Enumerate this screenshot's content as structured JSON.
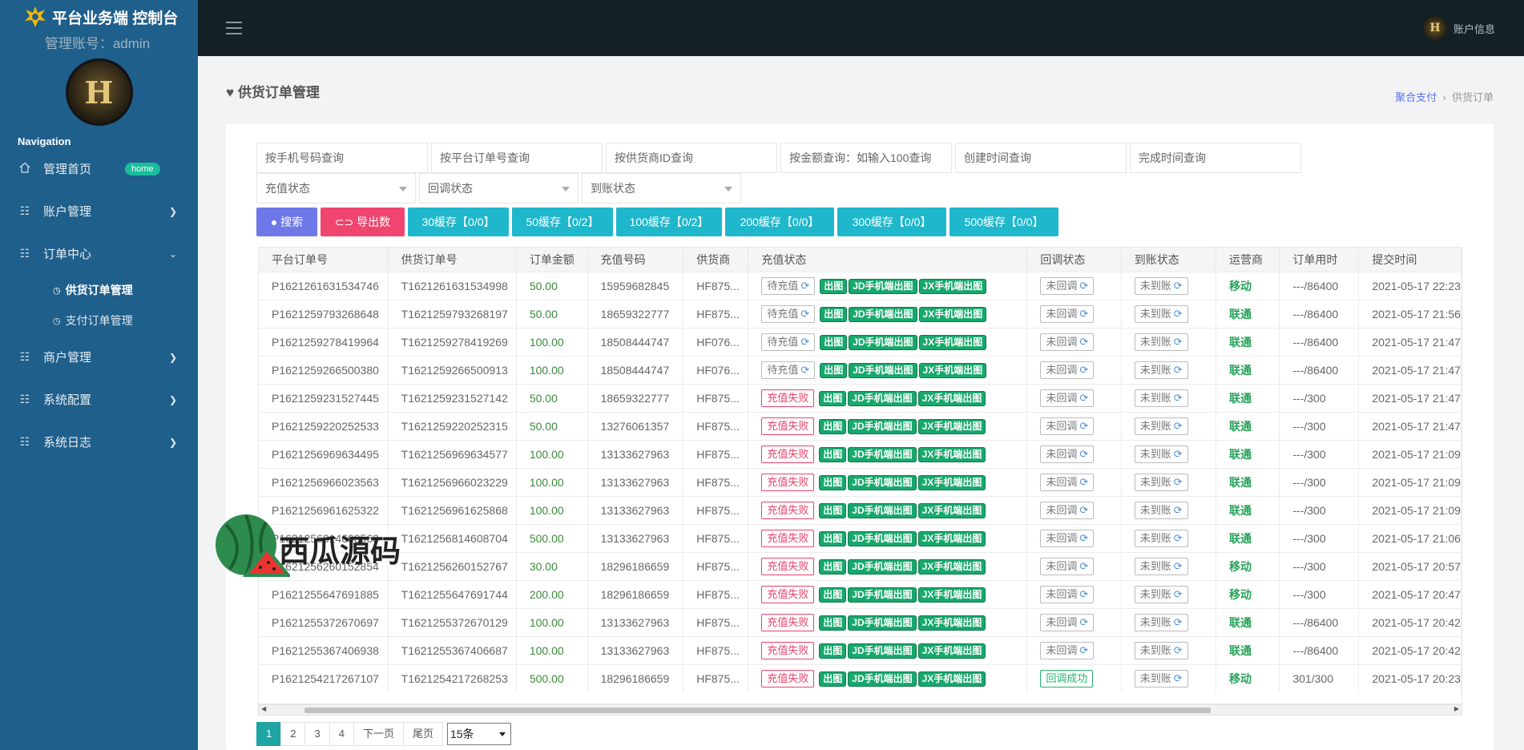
{
  "sidebar": {
    "brand": "平台业务端 控制台",
    "admin_line": "管理账号：admin",
    "avatar_letter": "H",
    "nav_caption": "Navigation",
    "items": [
      {
        "label": "管理首页",
        "badge": "home",
        "icon": "home-icon"
      },
      {
        "label": "账户管理",
        "icon": "list-icon"
      },
      {
        "label": "订单中心",
        "icon": "list-icon",
        "expanded": true,
        "children": [
          {
            "label": "供货订单管理",
            "active": true
          },
          {
            "label": "支付订单管理"
          }
        ]
      },
      {
        "label": "商户管理",
        "icon": "list-icon"
      },
      {
        "label": "系统配置",
        "icon": "list-icon"
      },
      {
        "label": "系统日志",
        "icon": "list-icon"
      }
    ]
  },
  "topbar": {
    "account_label": "账户信息"
  },
  "page": {
    "title": "供货订单管理",
    "breadcrumb": [
      "聚合支付",
      "供货订单"
    ]
  },
  "filters": {
    "phone": "按手机号码查询",
    "platform_order": "按平台订单号查询",
    "supplier_id": "按供货商ID查询",
    "amount": "按金额查询：如输入100查询",
    "created_time": "创建时间查询",
    "finished_time": "完成时间查询",
    "recharge_status": "充值状态",
    "callback_status": "回调状态",
    "arrival_status": "到账状态"
  },
  "buttons": {
    "search": "搜索",
    "export": "导出数据",
    "cache": [
      "30缓存【0/0】",
      "50缓存【0/2】",
      "100缓存【0/2】",
      "200缓存【0/0】",
      "300缓存【0/0】",
      "500缓存【0/0】"
    ]
  },
  "table": {
    "headers": [
      "平台订单号",
      "供货订单号",
      "订单金额",
      "充值号码",
      "供货商",
      "充值状态",
      "回调状态",
      "到账状态",
      "运营商",
      "订单用时",
      "提交时间"
    ],
    "tags": [
      "出图",
      "JD手机端出图",
      "JX手机端出图"
    ],
    "rows": [
      {
        "platform": "P1621261631534746",
        "supply": "T1621261631534998",
        "amount": "50.00",
        "phone": "15959682845",
        "supplier": "HF875...",
        "status": "待充值",
        "callback": "未回调",
        "arrival": "未到账",
        "op": "移动",
        "time_used": "---/86400",
        "submitted": "2021-05-17 22:23"
      },
      {
        "platform": "P1621259793268648",
        "supply": "T1621259793268197",
        "amount": "50.00",
        "phone": "18659322777",
        "supplier": "HF875...",
        "status": "待充值",
        "callback": "未回调",
        "arrival": "未到账",
        "op": "联通",
        "time_used": "---/86400",
        "submitted": "2021-05-17 21:56"
      },
      {
        "platform": "P1621259278419964",
        "supply": "T1621259278419269",
        "amount": "100.00",
        "phone": "18508444747",
        "supplier": "HF076...",
        "status": "待充值",
        "callback": "未回调",
        "arrival": "未到账",
        "op": "联通",
        "time_used": "---/86400",
        "submitted": "2021-05-17 21:47"
      },
      {
        "platform": "P1621259266500380",
        "supply": "T1621259266500913",
        "amount": "100.00",
        "phone": "18508444747",
        "supplier": "HF076...",
        "status": "待充值",
        "callback": "未回调",
        "arrival": "未到账",
        "op": "联通",
        "time_used": "---/86400",
        "submitted": "2021-05-17 21:47"
      },
      {
        "platform": "P1621259231527445",
        "supply": "T1621259231527142",
        "amount": "50.00",
        "phone": "18659322777",
        "supplier": "HF875...",
        "status": "充值失败",
        "callback": "未回调",
        "arrival": "未到账",
        "op": "联通",
        "time_used": "---/300",
        "submitted": "2021-05-17 21:47"
      },
      {
        "platform": "P1621259220252533",
        "supply": "T1621259220252315",
        "amount": "50.00",
        "phone": "13276061357",
        "supplier": "HF875...",
        "status": "充值失败",
        "callback": "未回调",
        "arrival": "未到账",
        "op": "联通",
        "time_used": "---/300",
        "submitted": "2021-05-17 21:47"
      },
      {
        "platform": "P1621256969634495",
        "supply": "T1621256969634577",
        "amount": "100.00",
        "phone": "13133627963",
        "supplier": "HF875...",
        "status": "充值失败",
        "callback": "未回调",
        "arrival": "未到账",
        "op": "联通",
        "time_used": "---/300",
        "submitted": "2021-05-17 21:09"
      },
      {
        "platform": "P1621256966023563",
        "supply": "T1621256966023229",
        "amount": "100.00",
        "phone": "13133627963",
        "supplier": "HF875...",
        "status": "充值失败",
        "callback": "未回调",
        "arrival": "未到账",
        "op": "联通",
        "time_used": "---/300",
        "submitted": "2021-05-17 21:09"
      },
      {
        "platform": "P1621256961625322",
        "supply": "T1621256961625868",
        "amount": "100.00",
        "phone": "13133627963",
        "supplier": "HF875...",
        "status": "充值失败",
        "callback": "未回调",
        "arrival": "未到账",
        "op": "联通",
        "time_used": "---/300",
        "submitted": "2021-05-17 21:09"
      },
      {
        "platform": "P1621256814608563",
        "supply": "T1621256814608704",
        "amount": "500.00",
        "phone": "13133627963",
        "supplier": "HF875...",
        "status": "充值失败",
        "callback": "未回调",
        "arrival": "未到账",
        "op": "联通",
        "time_used": "---/300",
        "submitted": "2021-05-17 21:06"
      },
      {
        "platform": "P1621256260152854",
        "supply": "T1621256260152767",
        "amount": "30.00",
        "phone": "18296186659",
        "supplier": "HF875...",
        "status": "充值失败",
        "callback": "未回调",
        "arrival": "未到账",
        "op": "移动",
        "time_used": "---/300",
        "submitted": "2021-05-17 20:57"
      },
      {
        "platform": "P1621255647691885",
        "supply": "T1621255647691744",
        "amount": "200.00",
        "phone": "18296186659",
        "supplier": "HF875...",
        "status": "充值失败",
        "callback": "未回调",
        "arrival": "未到账",
        "op": "移动",
        "time_used": "---/300",
        "submitted": "2021-05-17 20:47"
      },
      {
        "platform": "P1621255372670697",
        "supply": "T1621255372670129",
        "amount": "100.00",
        "phone": "13133627963",
        "supplier": "HF875...",
        "status": "充值失败",
        "callback": "未回调",
        "arrival": "未到账",
        "op": "联通",
        "time_used": "---/86400",
        "submitted": "2021-05-17 20:42"
      },
      {
        "platform": "P1621255367406938",
        "supply": "T1621255367406687",
        "amount": "100.00",
        "phone": "13133627963",
        "supplier": "HF875...",
        "status": "充值失败",
        "callback": "未回调",
        "arrival": "未到账",
        "op": "联通",
        "time_used": "---/86400",
        "submitted": "2021-05-17 20:42"
      },
      {
        "platform": "P1621254217267107",
        "supply": "T1621254217268253",
        "amount": "500.00",
        "phone": "18296186659",
        "supplier": "HF875...",
        "status": "充值失败",
        "callback": "回调成功",
        "arrival": "未到账",
        "op": "移动",
        "time_used": "301/300",
        "submitted": "2021-05-17 20:23"
      }
    ]
  },
  "pagination": {
    "pages": [
      "1",
      "2",
      "3",
      "4"
    ],
    "next": "下一页",
    "last": "尾页",
    "page_size": "15条"
  },
  "watermark": "西瓜源码",
  "colors": {
    "sidebar": "#1f5f8b",
    "topbar": "#132026",
    "accent_teal": "#1fb7cc",
    "danger": "#e8436b",
    "success": "#17a86c"
  }
}
